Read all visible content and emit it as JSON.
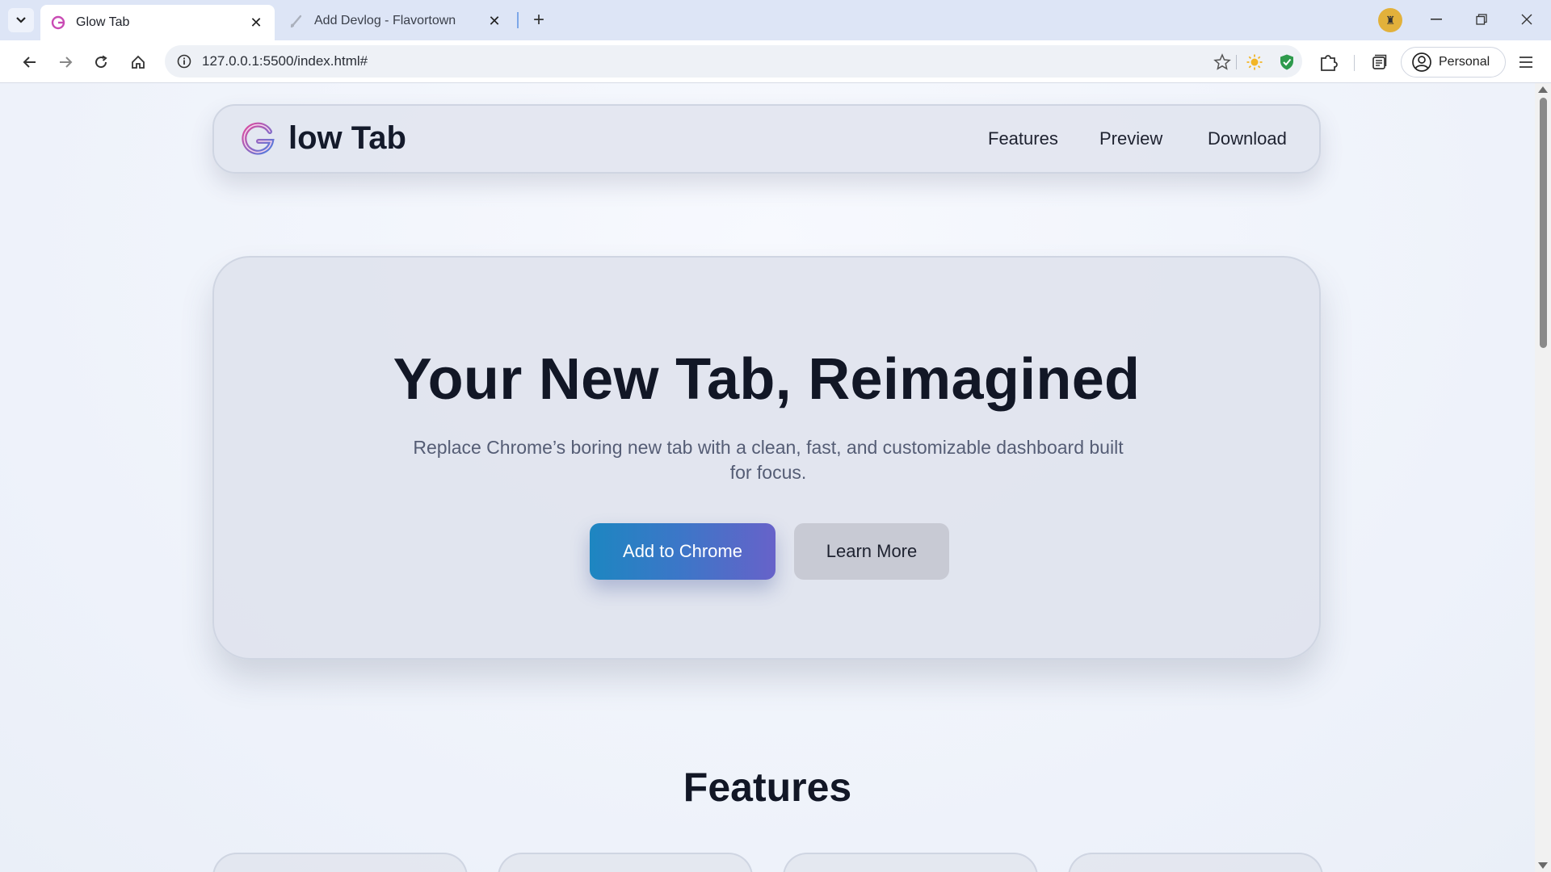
{
  "browser": {
    "tabs": [
      {
        "title": "Glow Tab",
        "active": true,
        "icon": "glow-tab-favicon"
      },
      {
        "title": "Add Devlog - Flavortown",
        "active": false,
        "icon": "brush-favicon"
      }
    ],
    "url": "127.0.0.1:5500/index.html#",
    "profile_label": "Personal"
  },
  "site": {
    "brand": "low Tab",
    "nav": [
      "Features",
      "Preview",
      "Download"
    ],
    "hero": {
      "title": "Your New Tab, Reimagined",
      "subtitle": "Replace Chrome’s boring new tab with a clean, fast, and customizable dashboard built for focus.",
      "primary_button": "Add to Chrome",
      "secondary_button": "Learn More"
    },
    "features_heading": "Features"
  },
  "colors": {
    "accent_gradient_start": "#1d86c1",
    "accent_gradient_end": "#6762c9",
    "logo_pink": "#d23aa8",
    "logo_blue": "#4e7fe0"
  }
}
